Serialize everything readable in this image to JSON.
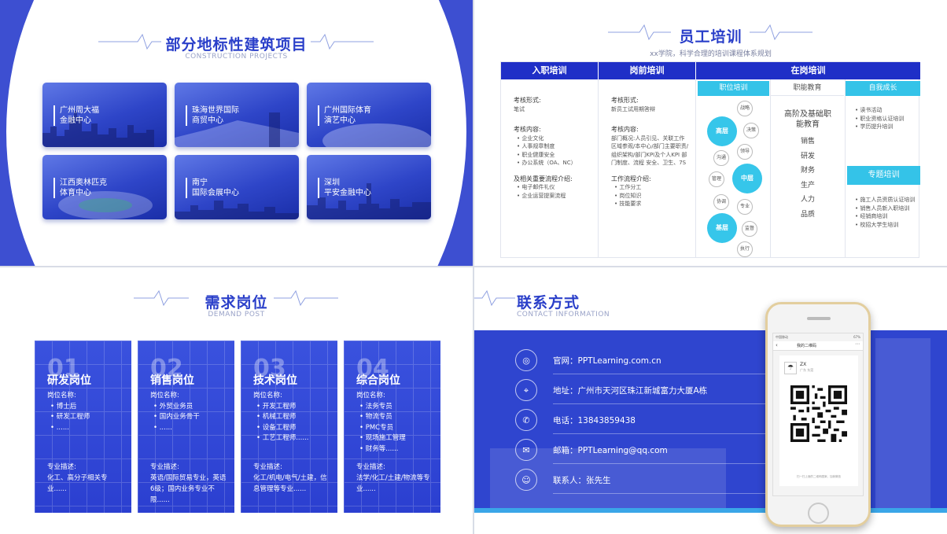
{
  "colors": {
    "primary": "#2a3fc9",
    "accent": "#34c3e8",
    "header": "#1f2fc7"
  },
  "projects": {
    "title": "部分地标性建筑项目",
    "subtitle": "CONSTRUCTION PROJECTS",
    "items": [
      {
        "line1": "广州周大福",
        "line2": "金融中心"
      },
      {
        "line1": "珠海世界国际",
        "line2": "商贸中心"
      },
      {
        "line1": "广州国际体育",
        "line2": "演艺中心"
      },
      {
        "line1": "江西奥林匹克",
        "line2": "体育中心"
      },
      {
        "line1": "南宁",
        "line2": "国际会展中心"
      },
      {
        "line1": "深圳",
        "line2": "平安金融中心"
      }
    ]
  },
  "training": {
    "title": "员工培训",
    "subtitle": "xx学院，科学合理的培训课程体系规划",
    "headers": [
      "入职培训",
      "岗前培训",
      "在岗培训"
    ],
    "subheaders": [
      "职位培训",
      "职能教育",
      "自我成长"
    ],
    "col1": {
      "form_label": "考核形式:",
      "form_value": "笔试",
      "content_label": "考核内容:",
      "content_items": [
        "企业文化",
        "人事规章制度",
        "职业健康安全",
        "办公系统（OA、NC）"
      ],
      "process_label": "及相关重要流程介绍:",
      "process_items": [
        "电子邮件礼仪",
        "企业运营提案流程"
      ]
    },
    "col2": {
      "form_label": "考核形式:",
      "form_value": "新员工试用期答辩",
      "content_label": "考核内容:",
      "content_text": "部门概况:人员引见、关联工作区域参观/本中心/部门主要职责/组织架构/部门KPI及个人KPI 部门制度、流程 安全、卫生、7S",
      "flow_label": "工作流程介绍:",
      "flow_items": [
        "工作分工",
        "岗位知识",
        "技能要求"
      ]
    },
    "levels": {
      "high": "高层",
      "mid": "中层",
      "base": "基层"
    },
    "skills_small": [
      "战略",
      "决策",
      "沟通",
      "领导",
      "管理",
      "协调",
      "专业",
      "监督",
      "执行"
    ],
    "function": {
      "title": "高阶及基础职能教育",
      "items": [
        "销售",
        "研发",
        "财务",
        "生产",
        "人力",
        "品质"
      ]
    },
    "growth_items": [
      "读书活动",
      "职业资格认证培训",
      "学历提升培训"
    ],
    "special": {
      "title": "专题培训",
      "items": [
        "施工人员资质认证培训",
        "销售人员新入职培训",
        "经销商培训",
        "校招大学生培训"
      ]
    }
  },
  "positions": {
    "title": "需求岗位",
    "subtitle": "DEMAND POST",
    "cards": [
      {
        "num": "01",
        "title": "研发岗位",
        "name_label": "岗位名称:",
        "items": [
          "博士后",
          "研发工程师",
          "......"
        ],
        "desc_label": "专业描述:",
        "desc": "化工、高分子相关专业......"
      },
      {
        "num": "02",
        "title": "销售岗位",
        "name_label": "岗位名称:",
        "items": [
          "外贸业务员",
          "国内业务骨干",
          "......"
        ],
        "desc_label": "专业描述:",
        "desc": "英语/国际贸易专业，英语6级；国内业务专业不限......"
      },
      {
        "num": "03",
        "title": "技术岗位",
        "name_label": "岗位名称:",
        "items": [
          "开发工程师",
          "机械工程师",
          "设备工程师",
          "工艺工程师......"
        ],
        "desc_label": "专业描述:",
        "desc": "化工/机电/电气/土建，信息管理等专业......"
      },
      {
        "num": "04",
        "title": "综合岗位",
        "name_label": "岗位名称:",
        "items": [
          "法务专员",
          "物流专员",
          "PMC专员",
          "现场施工管理",
          "财务等......"
        ],
        "desc_label": "专业描述:",
        "desc": "法学/化工/土建/物流等专业......"
      }
    ]
  },
  "contact": {
    "title": "联系方式",
    "subtitle": "CONTACT INFORMATION",
    "rows": [
      {
        "icon": "globe-icon",
        "glyph": "◎",
        "text": "官网：PPTLearning.com.cn"
      },
      {
        "icon": "location-icon",
        "glyph": "⌖",
        "text": "地址：广州市天河区珠江新城富力大厦A栋"
      },
      {
        "icon": "phone-icon",
        "glyph": "✆",
        "text": "电话：13843859438"
      },
      {
        "icon": "mail-icon",
        "glyph": "✉",
        "text": "邮箱：PPTLearning@qq.com"
      },
      {
        "icon": "user-icon",
        "glyph": "☺",
        "text": "联系人：张先生"
      }
    ],
    "phone": {
      "status": "中国移动",
      "battery": "67%",
      "title": "我的二维码",
      "user": "ZX",
      "region": "广东 东莞",
      "scan_hint": "扫一扫上面的二维码图案，加我微信"
    }
  }
}
